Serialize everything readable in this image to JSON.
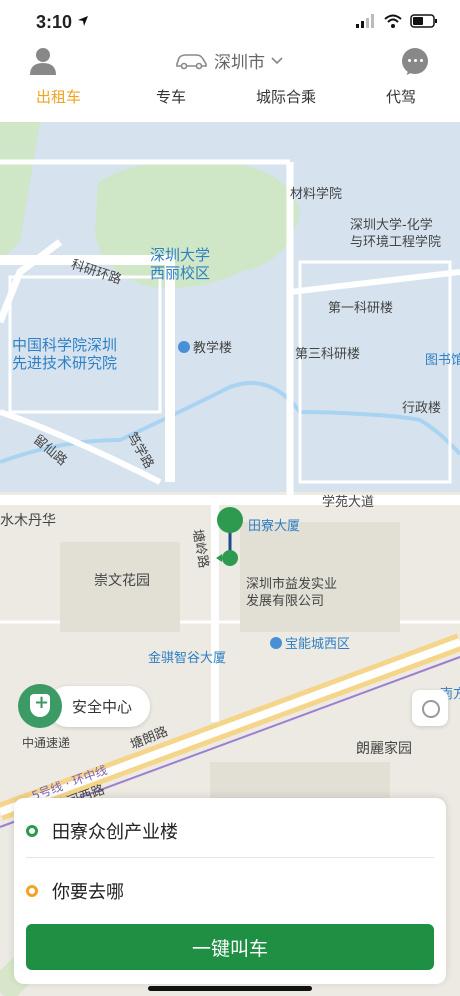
{
  "status_bar": {
    "time": "3:10"
  },
  "header": {
    "city": "深圳市"
  },
  "tabs": [
    {
      "label": "出租车",
      "active": true
    },
    {
      "label": "专车",
      "active": false
    },
    {
      "label": "城际合乘",
      "active": false
    },
    {
      "label": "代驾",
      "active": false
    }
  ],
  "map": {
    "labels": {
      "materials": "材料学院",
      "chem1": "深圳大学-化学",
      "chem2": "与环境工程学院",
      "szu1": "深圳大学",
      "szu2": "西丽校区",
      "keyan_rd": "科研环路",
      "first_lab": "第一科研楼",
      "cas1": "中国科学院深圳",
      "cas2": "先进技术研究院",
      "teaching": "教学楼",
      "third_lab": "第三科研楼",
      "library": "图书馆",
      "admin": "行政楼",
      "liuxian_rd": "留仙路",
      "duxue_rd": "笃学路",
      "xueyuan_rd": "学苑大道",
      "shuimu": "水木丹华",
      "building": "田寮大厦",
      "tangling_rd": "塘岭路",
      "chongwen": "崇文花园",
      "yifa1": "深圳市益发实业",
      "yifa2": "发展有限公司",
      "jinqi": "金骐智谷大厦",
      "baoneng": "宝能城西区",
      "zhongtong": "中通速递",
      "tanglang": "塘朗路",
      "line5": "5号线 · 环中线",
      "shahe": "沙河西路",
      "langli": "朗麗家园",
      "nanfang": "南方"
    },
    "safety_label": "安全中心",
    "colors": {
      "land": "#eceae2",
      "campus": "#d6e3ef",
      "green": "#cfe6c7",
      "water": "#a9d3f0",
      "metro": "#9b7fd1",
      "road": "#ffffff",
      "marker": "#2e9a4f"
    }
  },
  "route": {
    "origin": "田寮众创产业楼",
    "destination_placeholder": "你要去哪",
    "call_button": "一键叫车"
  }
}
